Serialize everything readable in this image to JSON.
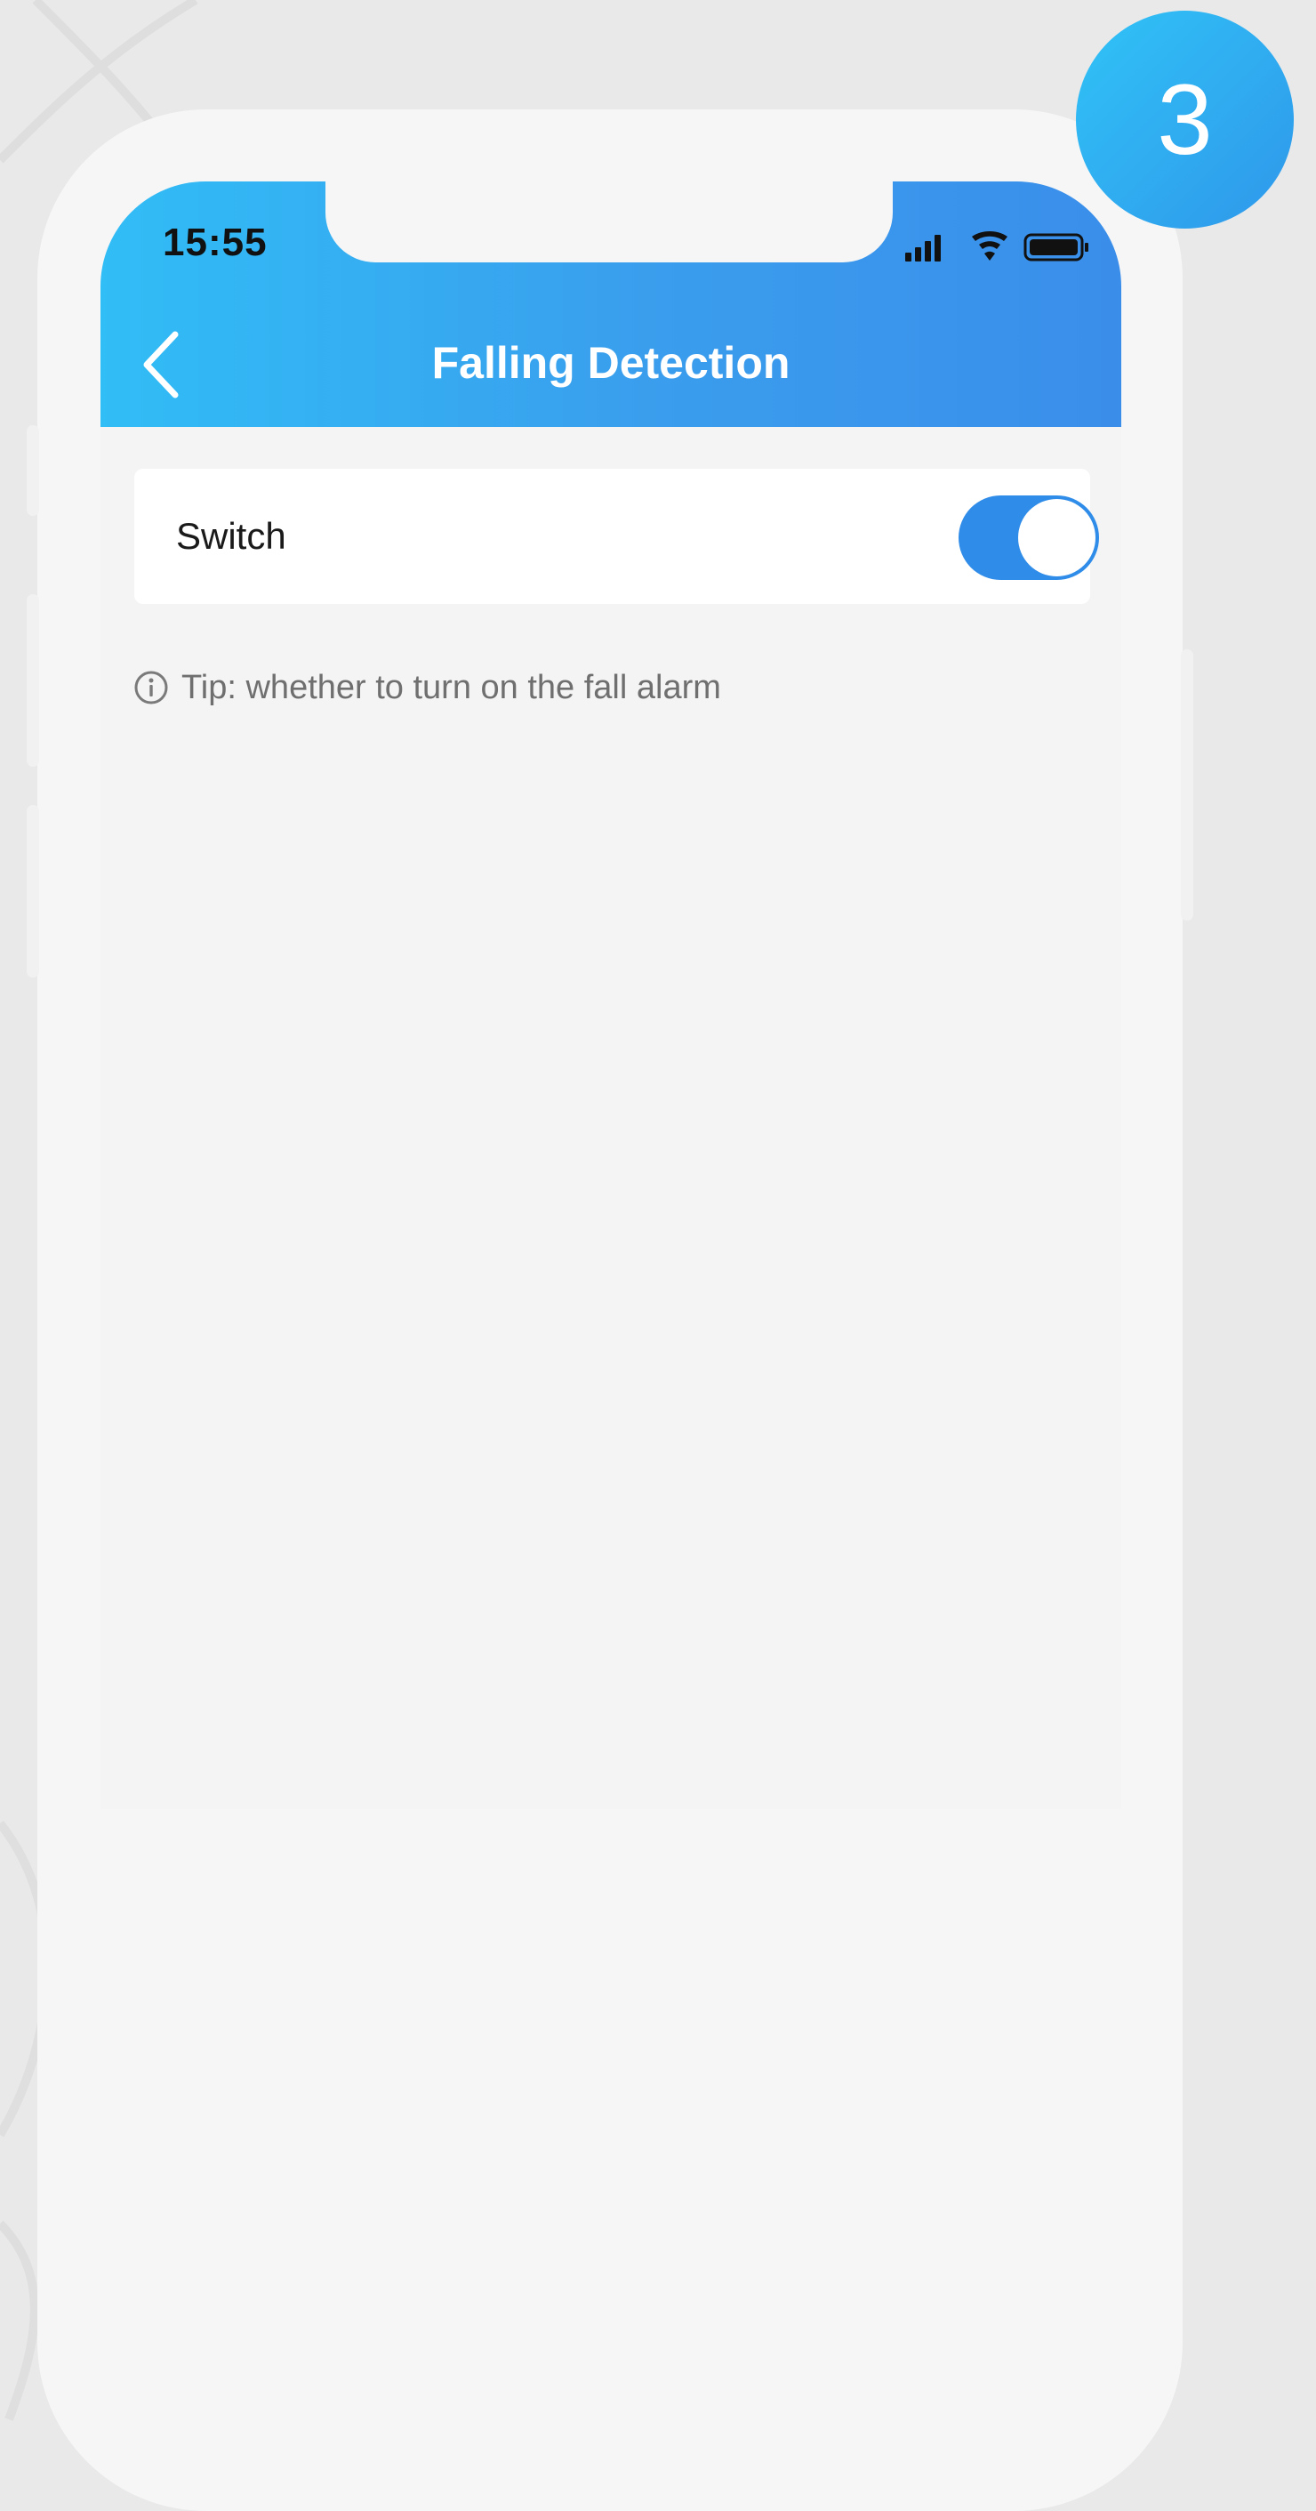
{
  "step_badge": "3",
  "status_bar": {
    "time": "15:55",
    "icons": [
      "signal-icon",
      "wifi-icon",
      "battery-icon"
    ]
  },
  "header": {
    "title": "Falling Detection",
    "back_icon": "chevron-left-icon"
  },
  "settings": {
    "switch_label": "Switch",
    "switch_on": true
  },
  "tip": {
    "icon": "info-icon",
    "text": "Tip: whether to turn on the fall alarm"
  },
  "colors": {
    "header_gradient_start": "#31bdf6",
    "header_gradient_end": "#3a8eea",
    "toggle_on": "#2f8ce8",
    "badge": "#2fa7f0"
  }
}
